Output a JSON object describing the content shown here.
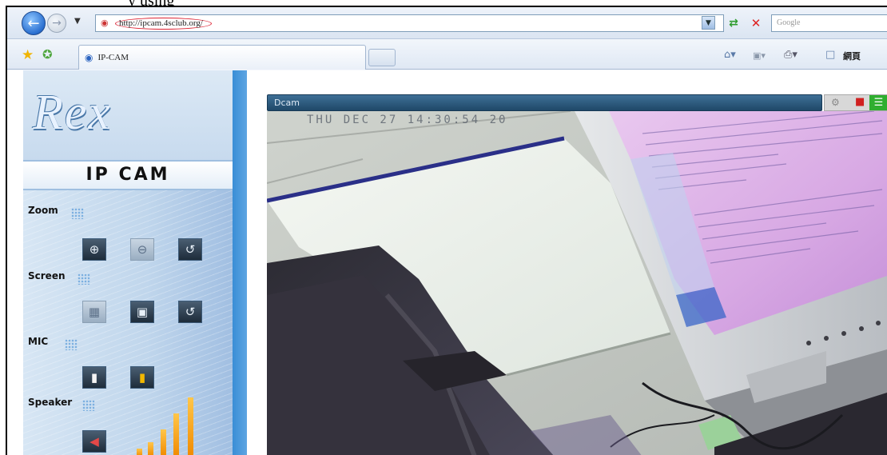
{
  "caption": {
    "text": "y using"
  },
  "browser": {
    "address_url": "http://ipcam.4sclub.org/",
    "search_placeholder": "Google",
    "tab_title": "IP-CAM",
    "page_menu_label": "網頁"
  },
  "sidebar": {
    "logo_text": "Rex",
    "title": "IP CAM",
    "sections": {
      "zoom": {
        "label": "Zoom"
      },
      "screen": {
        "label": "Screen"
      },
      "mic": {
        "label": "MIC"
      },
      "speaker": {
        "label": "Speaker"
      }
    },
    "speaker_volume_level": 5,
    "speaker_volume_max": 5
  },
  "camera": {
    "title": "Dcam",
    "osd_text": "THU DEC 27 14:30:54 20"
  },
  "icons": {
    "back": "back-arrow-icon",
    "forward": "forward-arrow-icon",
    "refresh": "refresh-icon",
    "stop": "stop-icon",
    "favorites": "star-icon",
    "add_favorite": "add-favorite-icon",
    "home": "home-icon",
    "feeds": "feed-icon",
    "print": "print-icon",
    "page": "page-icon",
    "zoom_in": "zoom-in-icon",
    "zoom_out": "zoom-out-icon",
    "reset": "reset-icon",
    "fullscreen_exit": "shrink-screen-icon",
    "fullscreen": "expand-screen-icon",
    "mic_on": "microphone-icon",
    "mic_active": "microphone-active-icon",
    "speaker": "speaker-icon"
  },
  "colors": {
    "browser_blue": "#2a6fd0",
    "sidebar_stripe": "#3a8ed6",
    "volume_orange": "#f08a00",
    "cam_bar": "#1f4868",
    "fullscreen_green": "#2fae2f"
  }
}
